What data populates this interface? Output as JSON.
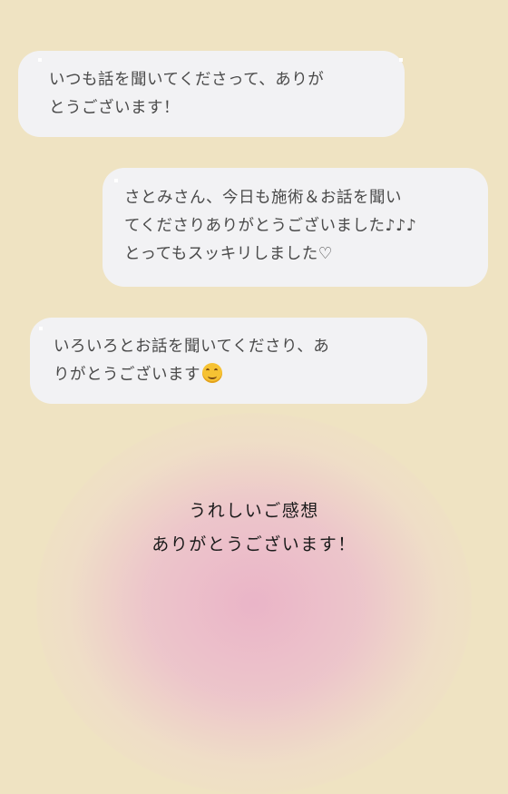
{
  "messages": [
    {
      "lines": [
        "いつも話を聞いてくださって、ありが",
        "とうございます！"
      ]
    },
    {
      "lines": [
        "さとみさん、今日も施術＆お話を聞い",
        "てくださりありがとうございました♪♪♪",
        "とってもスッキリしました♡"
      ]
    },
    {
      "lines": [
        "いろいろとお話を聞いてくださり、あ",
        "りがとうございます"
      ],
      "emoji": "smiling-face-emoji"
    }
  ],
  "caption": {
    "line1": "うれしいご感想",
    "line2": "ありがとうございます！"
  },
  "colors": {
    "background": "#efe3c2",
    "bubble": "#f2f2f4",
    "glow": "#eab2c8"
  }
}
